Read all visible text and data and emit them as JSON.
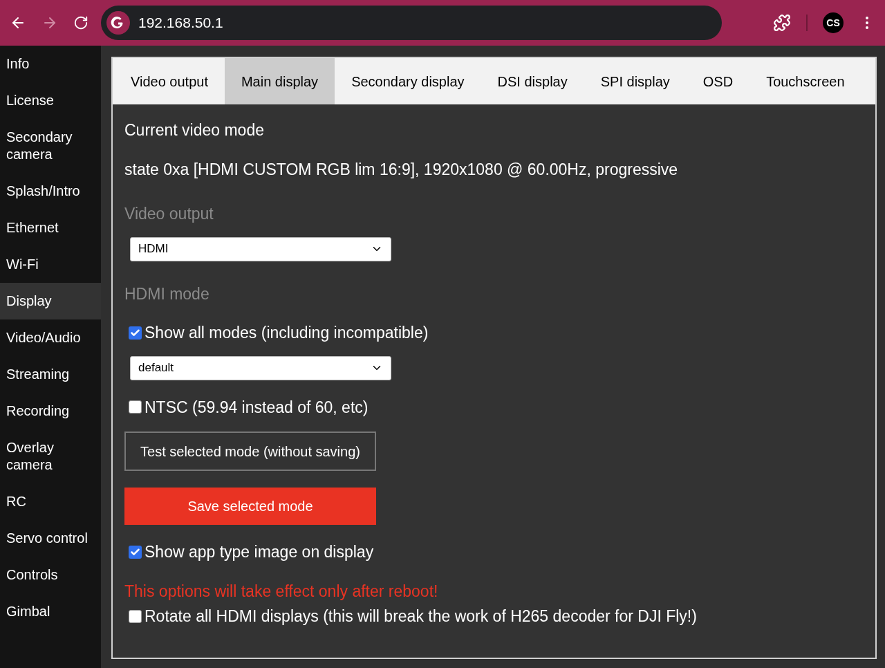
{
  "browser": {
    "back_enabled": true,
    "forward_enabled": false,
    "url": "192.168.50.1",
    "avatar": "CS"
  },
  "sidebar": {
    "items": [
      {
        "label": "Info",
        "selected": false
      },
      {
        "label": "License",
        "selected": false
      },
      {
        "label": "Secondary camera",
        "selected": false
      },
      {
        "label": "Splash/Intro",
        "selected": false
      },
      {
        "label": "Ethernet",
        "selected": false
      },
      {
        "label": "Wi-Fi",
        "selected": false
      },
      {
        "label": "Display",
        "selected": true
      },
      {
        "label": "Video/Audio",
        "selected": false
      },
      {
        "label": "Streaming",
        "selected": false
      },
      {
        "label": "Recording",
        "selected": false
      },
      {
        "label": "Overlay camera",
        "selected": false
      },
      {
        "label": "RC",
        "selected": false
      },
      {
        "label": "Servo control",
        "selected": false
      },
      {
        "label": "Controls",
        "selected": false
      },
      {
        "label": "Gimbal",
        "selected": false
      }
    ]
  },
  "tabs": [
    {
      "label": "Video output",
      "selected": false
    },
    {
      "label": "Main display",
      "selected": true
    },
    {
      "label": "Secondary display",
      "selected": false
    },
    {
      "label": "DSI display",
      "selected": false
    },
    {
      "label": "SPI display",
      "selected": false
    },
    {
      "label": "OSD",
      "selected": false
    },
    {
      "label": "Touchscreen",
      "selected": false
    }
  ],
  "content": [
    {
      "kind": "heading",
      "text": "Current video mode"
    },
    {
      "kind": "text",
      "text": "state 0xa [HDMI CUSTOM RGB lim 16:9], 1920x1080 @ 60.00Hz, progressive"
    },
    {
      "kind": "label",
      "text": "Video output"
    },
    {
      "kind": "select",
      "value": "HDMI"
    },
    {
      "kind": "label",
      "text": "HDMI mode"
    },
    {
      "kind": "checkbox",
      "text": "Show all modes (including incompatible)",
      "checked": true
    },
    {
      "kind": "select",
      "value": "default"
    },
    {
      "kind": "checkbox",
      "text": "NTSC (59.94 instead of 60, etc)",
      "checked": false
    },
    {
      "kind": "outline_button",
      "text": "Test selected mode (without saving)"
    },
    {
      "kind": "primary_button",
      "text": "Save selected mode"
    },
    {
      "kind": "checkbox",
      "text": "Show app type image on display",
      "checked": true
    },
    {
      "kind": "warning",
      "text": "This options will take effect only after reboot!"
    },
    {
      "kind": "checkbox",
      "text": "Rotate all HDMI displays (this will break the work of H265 decoder for DJI Fly!)",
      "checked": false
    }
  ]
}
